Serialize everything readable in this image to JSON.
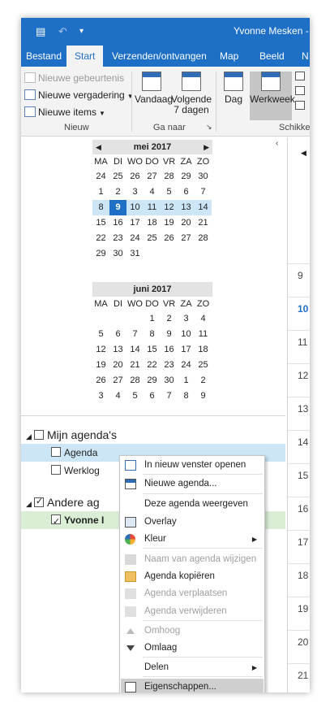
{
  "titlebar": {
    "title": "Yvonne Mesken - Age",
    "undo_icon": "undo-icon",
    "customize_icon": "dropdown-icon"
  },
  "tabs": [
    "Bestand",
    "Start",
    "Verzenden/ontvangen",
    "Map",
    "Beeld",
    "N"
  ],
  "ribbon": {
    "new_group": {
      "new_appointment": "Nieuwe gebeurtenis",
      "new_meeting": "Nieuwe vergadering",
      "new_items": "Nieuwe items",
      "label": "Nieuw"
    },
    "goto_group": {
      "today": "Vandaag",
      "next7_line1": "Volgende",
      "next7_line2": "7 dagen",
      "label": "Ga naar"
    },
    "arrange_group": {
      "day": "Dag",
      "workweek": "Werkweek",
      "label": "Schikke"
    }
  },
  "calendar": {
    "month1": {
      "title": "mei 2017",
      "dow": [
        "MA",
        "DI",
        "WO",
        "DO",
        "VR",
        "ZA",
        "ZO"
      ],
      "weeks": [
        [
          "24",
          "25",
          "26",
          "27",
          "28",
          "29",
          "30"
        ],
        [
          "1",
          "2",
          "3",
          "4",
          "5",
          "6",
          "7"
        ],
        [
          "8",
          "9",
          "10",
          "11",
          "12",
          "13",
          "14"
        ],
        [
          "15",
          "16",
          "17",
          "18",
          "19",
          "20",
          "21"
        ],
        [
          "22",
          "23",
          "24",
          "25",
          "26",
          "27",
          "28"
        ],
        [
          "29",
          "30",
          "31",
          "",
          "",
          "",
          ""
        ]
      ]
    },
    "month2": {
      "title": "juni 2017",
      "dow": [
        "MA",
        "DI",
        "WO",
        "DO",
        "VR",
        "ZA",
        "ZO"
      ],
      "weeks": [
        [
          "",
          "",
          "",
          "1",
          "2",
          "3",
          "4"
        ],
        [
          "5",
          "6",
          "7",
          "8",
          "9",
          "10",
          "11"
        ],
        [
          "12",
          "13",
          "14",
          "15",
          "16",
          "17",
          "18"
        ],
        [
          "19",
          "20",
          "21",
          "22",
          "23",
          "24",
          "25"
        ],
        [
          "26",
          "27",
          "28",
          "29",
          "30",
          "1",
          "2"
        ],
        [
          "3",
          "4",
          "5",
          "6",
          "7",
          "8",
          "9"
        ]
      ]
    }
  },
  "folders": {
    "my_group": "Mijn agenda's",
    "agenda": "Agenda",
    "werklog": "Werklog",
    "other_group": "Andere ag",
    "yvonne": "Yvonne I"
  },
  "dayview": {
    "hours": [
      "9",
      "10",
      "11",
      "12",
      "13",
      "14",
      "15",
      "16",
      "17",
      "18",
      "19",
      "20",
      "21"
    ]
  },
  "context_menu": {
    "items": [
      {
        "label": "In nieuw venster openen",
        "icon": "new-window-icon"
      },
      {
        "label": "Nieuwe agenda...",
        "icon": "new-calendar-icon"
      },
      {
        "label": "Deze agenda weergeven",
        "icon": ""
      },
      {
        "label": "Overlay",
        "icon": "overlay-icon"
      },
      {
        "label": "Kleur",
        "icon": "color-icon"
      },
      {
        "label": "Naam van agenda wijzigen",
        "icon": "rename-icon"
      },
      {
        "label": "Agenda kopiëren",
        "icon": "copy-icon"
      },
      {
        "label": "Agenda verplaatsen",
        "icon": "move-icon"
      },
      {
        "label": "Agenda verwijderen",
        "icon": "delete-icon"
      },
      {
        "label": "Omhoog",
        "icon": "up-arrow-icon"
      },
      {
        "label": "Omlaag",
        "icon": "down-arrow-icon"
      },
      {
        "label": "Delen",
        "icon": ""
      },
      {
        "label": "Eigenschappen...",
        "icon": "properties-icon"
      }
    ]
  },
  "colors": {
    "accent": "#1e6fc6",
    "selection": "#cde6f7",
    "green_row": "#d9eed5"
  }
}
